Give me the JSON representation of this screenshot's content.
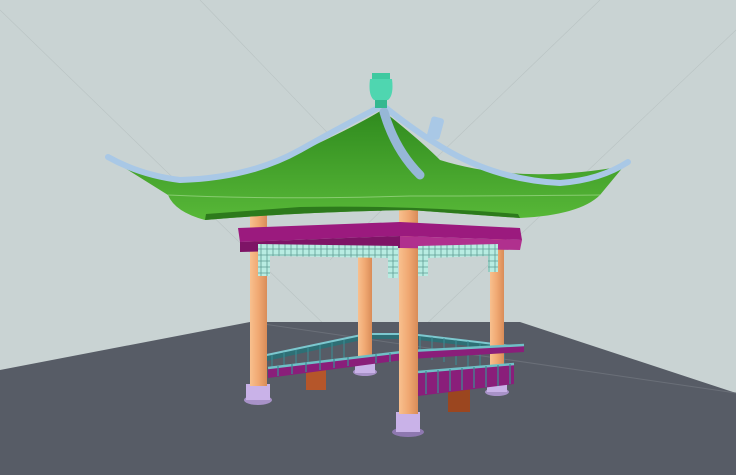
{
  "scene": {
    "sky_color": "#c9d3d3",
    "ground_color": "#575c66",
    "roof_color": "#3f9f2a",
    "roof_edge_color": "#a9c8e6",
    "beam_color": "#9b1a7e",
    "column_color": "#f0a872",
    "base_color": "#c9b2e8",
    "lattice_color": "#a8e0d8",
    "railing_color": "#3a8f96",
    "bench_color": "#b5562a",
    "finial_color": "#4fd6b0"
  }
}
